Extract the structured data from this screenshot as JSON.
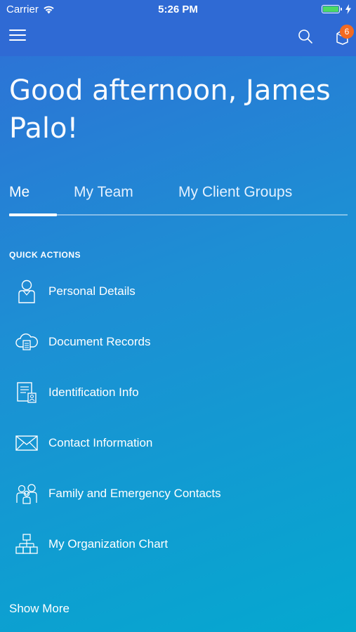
{
  "status_bar": {
    "carrier": "Carrier",
    "time": "5:26 PM"
  },
  "header": {
    "notification_count": "6"
  },
  "greeting": "Good afternoon, James Palo!",
  "tabs": [
    {
      "label": "Me",
      "active": true
    },
    {
      "label": "My Team",
      "active": false
    },
    {
      "label": "My Client Groups",
      "active": false
    }
  ],
  "quick_actions": {
    "title": "QUICK ACTIONS",
    "items": [
      {
        "label": "Personal Details",
        "icon": "person-icon"
      },
      {
        "label": "Document Records",
        "icon": "cloud-document-icon"
      },
      {
        "label": "Identification Info",
        "icon": "id-card-icon"
      },
      {
        "label": "Contact Information",
        "icon": "envelope-icon"
      },
      {
        "label": "Family and Emergency Contacts",
        "icon": "family-icon"
      },
      {
        "label": "My Organization Chart",
        "icon": "org-chart-icon"
      }
    ]
  },
  "show_more": "Show More",
  "colors": {
    "accent_blue": "#2f6ad4",
    "badge_orange": "#f26a21",
    "battery_green": "#4cd964"
  }
}
